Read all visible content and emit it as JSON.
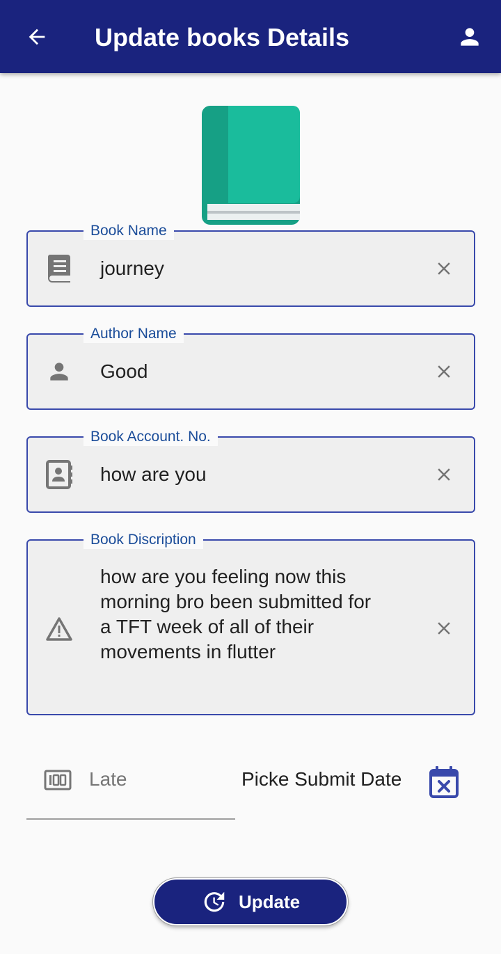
{
  "appbar": {
    "title": "Update books Details",
    "back_icon": "arrow-back-icon",
    "profile_icon": "person-icon",
    "background": "#1a237e"
  },
  "form": {
    "book_name": {
      "label": "Book Name",
      "value": "journey",
      "icon": "book-icon"
    },
    "author_name": {
      "label": "Author Name",
      "value": "Good",
      "icon": "person-icon"
    },
    "account_no": {
      "label": "Book Account. No.",
      "value": "how are you",
      "icon": "contact-card-icon"
    },
    "description": {
      "label": "Book Discription",
      "value": "how are you feeling now this morning bro been submitted for a TFT week of all of their movements in flutter",
      "icon": "warning-triangle-icon"
    },
    "late": {
      "placeholder": "Late",
      "icon": "counter-100-icon"
    },
    "submit_date": {
      "label": "Picke Submit Date",
      "icon": "calendar-cancel-icon"
    }
  },
  "actions": {
    "update_label": "Update",
    "update_icon": "refresh-icon"
  },
  "colors": {
    "accent": "#1a237e",
    "field_border": "#3949ab",
    "label": "#1a4c99",
    "book_cover": "#1abc9c"
  }
}
